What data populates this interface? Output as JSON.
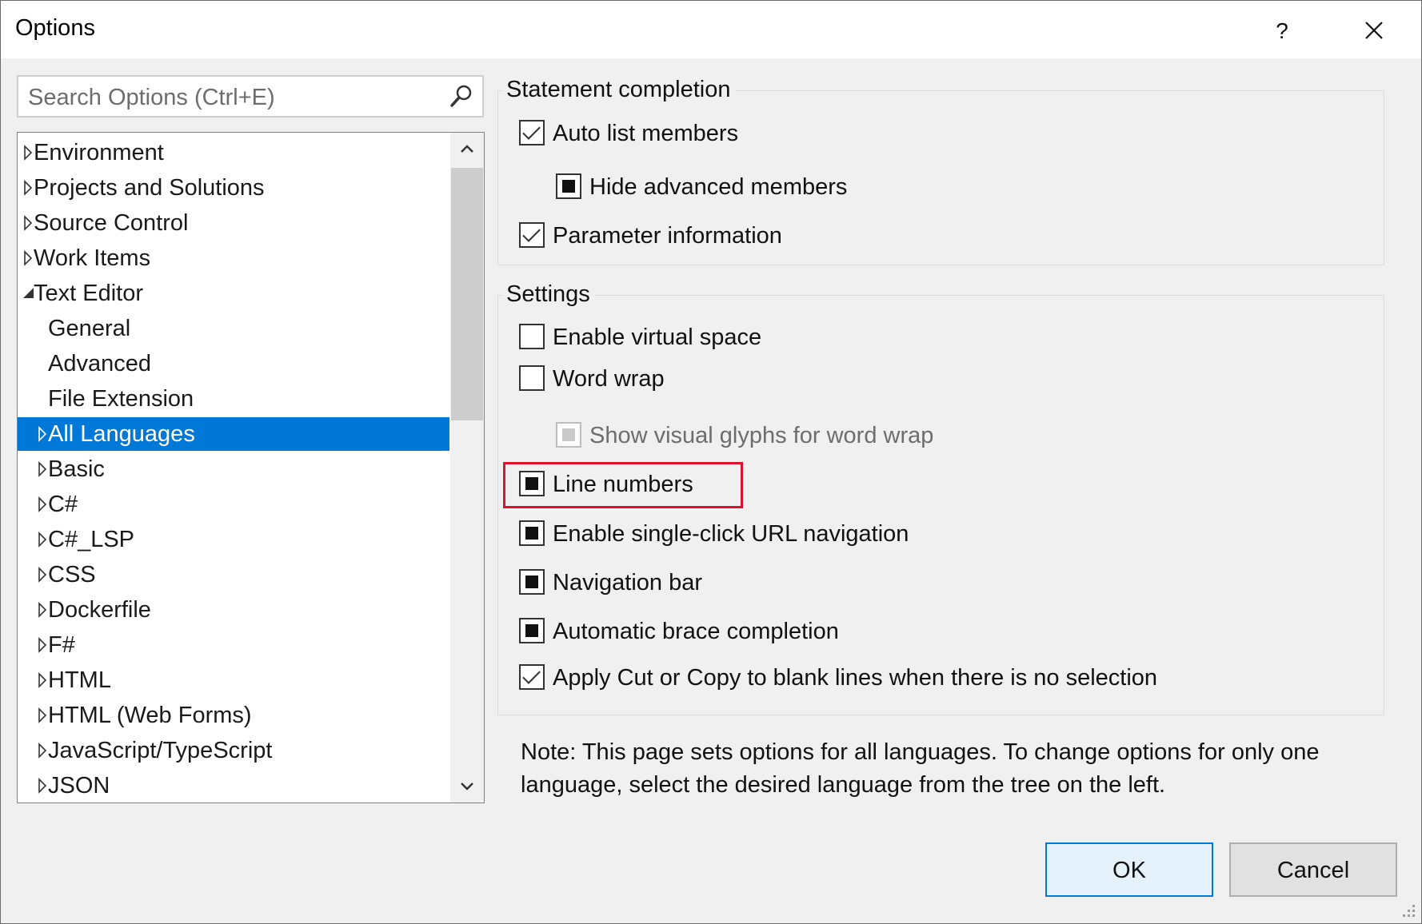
{
  "window": {
    "title": "Options",
    "help_label": "?"
  },
  "search": {
    "placeholder": "Search Options (Ctrl+E)",
    "value": ""
  },
  "tree": {
    "items": [
      {
        "label": "Environment",
        "level": 0,
        "expander": "collapsed",
        "selected": false
      },
      {
        "label": "Projects and Solutions",
        "level": 0,
        "expander": "collapsed",
        "selected": false
      },
      {
        "label": "Source Control",
        "level": 0,
        "expander": "collapsed",
        "selected": false
      },
      {
        "label": "Work Items",
        "level": 0,
        "expander": "collapsed",
        "selected": false
      },
      {
        "label": "Text Editor",
        "level": 0,
        "expander": "expanded",
        "selected": false
      },
      {
        "label": "General",
        "level": 1,
        "expander": "none",
        "selected": false
      },
      {
        "label": "Advanced",
        "level": 1,
        "expander": "none",
        "selected": false
      },
      {
        "label": "File Extension",
        "level": 1,
        "expander": "none",
        "selected": false
      },
      {
        "label": "All Languages",
        "level": 1,
        "expander": "collapsed",
        "selected": true
      },
      {
        "label": "Basic",
        "level": 1,
        "expander": "collapsed",
        "selected": false
      },
      {
        "label": "C#",
        "level": 1,
        "expander": "collapsed",
        "selected": false
      },
      {
        "label": "C#_LSP",
        "level": 1,
        "expander": "collapsed",
        "selected": false
      },
      {
        "label": "CSS",
        "level": 1,
        "expander": "collapsed",
        "selected": false
      },
      {
        "label": "Dockerfile",
        "level": 1,
        "expander": "collapsed",
        "selected": false
      },
      {
        "label": "F#",
        "level": 1,
        "expander": "collapsed",
        "selected": false
      },
      {
        "label": "HTML",
        "level": 1,
        "expander": "collapsed",
        "selected": false
      },
      {
        "label": "HTML (Web Forms)",
        "level": 1,
        "expander": "collapsed",
        "selected": false
      },
      {
        "label": "JavaScript/TypeScript",
        "level": 1,
        "expander": "collapsed",
        "selected": false
      },
      {
        "label": "JSON",
        "level": 1,
        "expander": "collapsed",
        "selected": false
      }
    ]
  },
  "statement_completion": {
    "label": "Statement completion",
    "options": [
      {
        "label": "Auto list members",
        "state": "checked",
        "indent": false,
        "disabled": false
      },
      {
        "label": "Hide advanced members",
        "state": "indeterminate",
        "indent": true,
        "disabled": false
      },
      {
        "label": "Parameter information",
        "state": "checked",
        "indent": false,
        "disabled": false
      }
    ]
  },
  "settings": {
    "label": "Settings",
    "options": [
      {
        "label": "Enable virtual space",
        "state": "unchecked",
        "indent": false,
        "disabled": false
      },
      {
        "label": "Word wrap",
        "state": "unchecked",
        "indent": false,
        "disabled": false
      },
      {
        "label": "Show visual glyphs for word wrap",
        "state": "indeterminate",
        "indent": true,
        "disabled": true
      },
      {
        "label": "Line numbers",
        "state": "indeterminate",
        "indent": false,
        "disabled": false,
        "highlighted": true
      },
      {
        "label": "Enable single-click URL navigation",
        "state": "indeterminate",
        "indent": false,
        "disabled": false
      },
      {
        "label": "Navigation bar",
        "state": "indeterminate",
        "indent": false,
        "disabled": false
      },
      {
        "label": "Automatic brace completion",
        "state": "indeterminate",
        "indent": false,
        "disabled": false
      },
      {
        "label": "Apply Cut or Copy to blank lines when there is no selection",
        "state": "checked",
        "indent": false,
        "disabled": false
      }
    ]
  },
  "note": "Note: This page sets options for all languages. To change options for only one language, select the desired language from the tree on the left.",
  "buttons": {
    "ok": "OK",
    "cancel": "Cancel"
  },
  "colors": {
    "selection": "#0078d7",
    "highlight_border": "#e0102c",
    "dialog_bg": "#f0f0f0"
  }
}
